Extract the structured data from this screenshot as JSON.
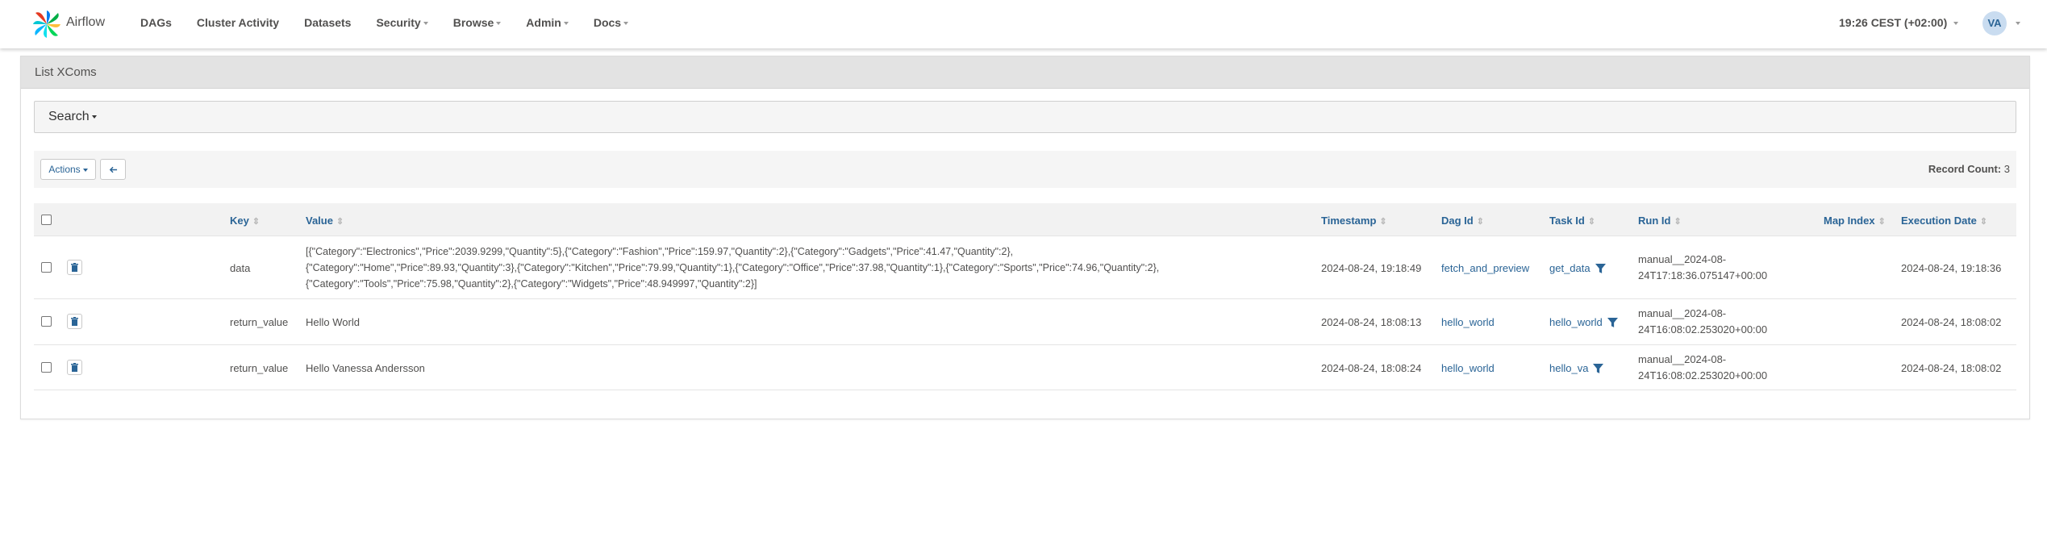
{
  "nav": {
    "brand": "Airflow",
    "items": [
      "DAGs",
      "Cluster Activity",
      "Datasets",
      "Security",
      "Browse",
      "Admin",
      "Docs"
    ],
    "time": "19:26 CEST (+02:00)",
    "user_initials": "VA"
  },
  "panel": {
    "title": "List XComs",
    "search_label": "Search",
    "actions_label": "Actions",
    "record_count_label": "Record Count:",
    "record_count": "3"
  },
  "table": {
    "headers": {
      "key": "Key",
      "value": "Value",
      "timestamp": "Timestamp",
      "dag_id": "Dag Id",
      "task_id": "Task Id",
      "run_id": "Run Id",
      "map_index": "Map Index",
      "execution_date": "Execution Date"
    },
    "rows": [
      {
        "key": "data",
        "value": "[{\"Category\":\"Electronics\",\"Price\":2039.9299,\"Quantity\":5},{\"Category\":\"Fashion\",\"Price\":159.97,\"Quantity\":2},{\"Category\":\"Gadgets\",\"Price\":41.47,\"Quantity\":2},\n{\"Category\":\"Home\",\"Price\":89.93,\"Quantity\":3},{\"Category\":\"Kitchen\",\"Price\":79.99,\"Quantity\":1},{\"Category\":\"Office\",\"Price\":37.98,\"Quantity\":1},{\"Category\":\"Sports\",\"Price\":74.96,\"Quantity\":2},\n{\"Category\":\"Tools\",\"Price\":75.98,\"Quantity\":2},{\"Category\":\"Widgets\",\"Price\":48.949997,\"Quantity\":2}]",
        "timestamp": "2024-08-24, 19:18:49",
        "dag_id": "fetch_and_preview",
        "task_id": "get_data",
        "run_id": "manual__2024-08-\n24T17:18:36.075147+00:00",
        "map_index": "",
        "execution_date": "2024-08-24, 19:18:36"
      },
      {
        "key": "return_value",
        "value": "Hello World",
        "timestamp": "2024-08-24, 18:08:13",
        "dag_id": "hello_world",
        "task_id": "hello_world",
        "run_id": "manual__2024-08-\n24T16:08:02.253020+00:00",
        "map_index": "",
        "execution_date": "2024-08-24, 18:08:02"
      },
      {
        "key": "return_value",
        "value": "Hello Vanessa Andersson",
        "timestamp": "2024-08-24, 18:08:24",
        "dag_id": "hello_world",
        "task_id": "hello_va",
        "run_id": "manual__2024-08-\n24T16:08:02.253020+00:00",
        "map_index": "",
        "execution_date": "2024-08-24, 18:08:02"
      }
    ]
  },
  "colors": {
    "link": "#2a6496",
    "text": "#51504f",
    "header_bg": "#e3e3e3"
  },
  "icons": [
    "airflow-logo-icon",
    "caret-down-icon",
    "arrow-left-icon",
    "trash-icon",
    "filter-icon",
    "sort-icon"
  ]
}
